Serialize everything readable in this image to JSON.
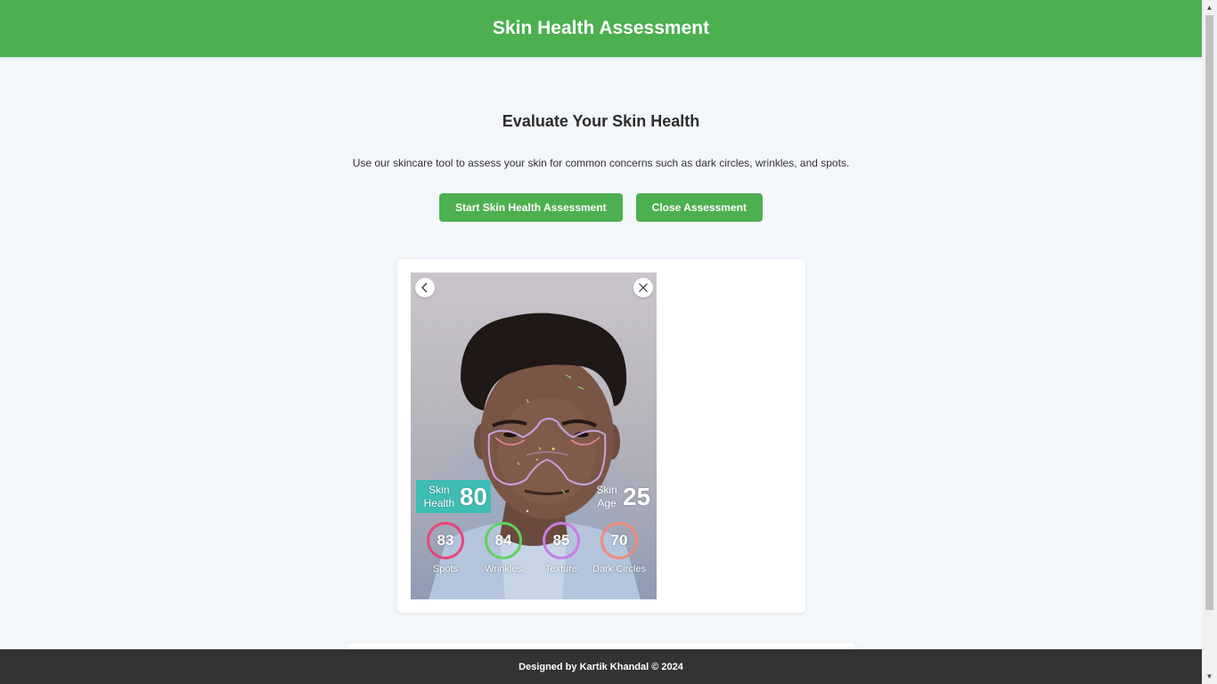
{
  "header": {
    "title": "Skin Health Assessment"
  },
  "main": {
    "heading": "Evaluate Your Skin Health",
    "description": "Use our skincare tool to assess your skin for common concerns such as dark circles, wrinkles, and spots.",
    "start_button": "Start Skin Health Assessment",
    "close_button": "Close Assessment"
  },
  "assessment": {
    "skin_health": {
      "label_line1": "Skin",
      "label_line2": "Health",
      "value": "80"
    },
    "skin_age": {
      "label_line1": "Skin",
      "label_line2": "Age",
      "value": "25"
    },
    "metrics": [
      {
        "label": "Spots",
        "value": "83",
        "color": "#e8457a"
      },
      {
        "label": "Wrinkles",
        "value": "84",
        "color": "#5fd35a"
      },
      {
        "label": "Texture",
        "value": "85",
        "color": "#c97be8"
      },
      {
        "label": "Dark Circles",
        "value": "70",
        "color": "#f08a7a"
      }
    ],
    "icons": {
      "back": "chevron-left-icon",
      "close": "close-icon"
    },
    "theme": {
      "skin_health_bg": "#3dbdb3",
      "overlay_line": "#c9a8e8"
    }
  },
  "footer": {
    "credit": "Designed by Kartik Khandal © 2024"
  },
  "colors": {
    "primary": "#4caf50",
    "background": "#f3f6fa",
    "footer_bg": "#333333"
  }
}
